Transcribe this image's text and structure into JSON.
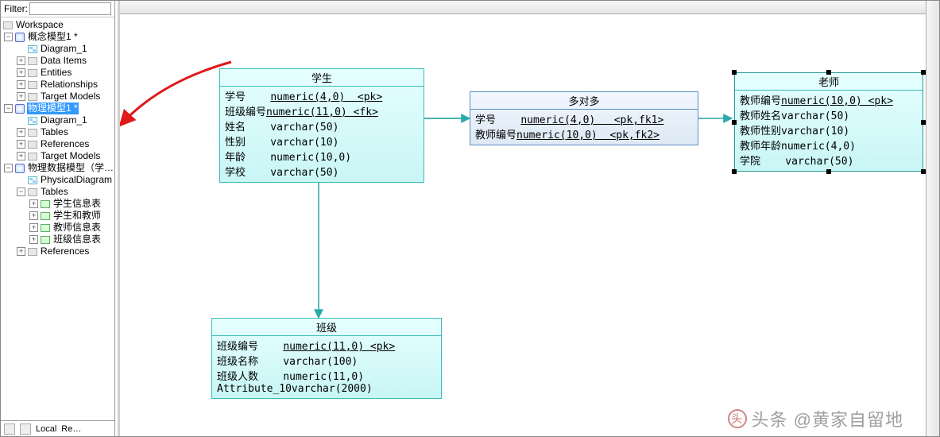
{
  "filter": {
    "label": "Filter:",
    "value": ""
  },
  "tree": {
    "root": "Workspace",
    "model_cpt": "概念模型1 *",
    "diagram1": "Diagram_1",
    "data_items": "Data Items",
    "entities": "Entities",
    "relationships": "Relationships",
    "target_models1": "Target Models",
    "model_phys": "物理模型1 *",
    "diagram1b": "Diagram_1",
    "tables_a": "Tables",
    "references_a": "References",
    "target_models2": "Target Models",
    "model_phys_data": "物理数据模型（学…",
    "phys_diagram": "PhysicalDiagram",
    "tables_b": "Tables",
    "t1": "学生信息表",
    "t2": "学生和教师",
    "t3": "教师信息表",
    "t4": "班级信息表",
    "references_b": "References"
  },
  "bottom": {
    "local": "Local",
    "repo": "Re…"
  },
  "entities": {
    "student": {
      "title": "学生",
      "rows": [
        {
          "name": "学号",
          "type": "numeric(4,0)",
          "key": "<pk>",
          "u": true
        },
        {
          "name": "班级编号",
          "type": "numeric(11,0)",
          "key": "<fk>",
          "u": true
        },
        {
          "name": "姓名",
          "type": "varchar(50)",
          "key": "",
          "u": false
        },
        {
          "name": "性别",
          "type": "varchar(10)",
          "key": "",
          "u": false
        },
        {
          "name": "年龄",
          "type": "numeric(10,0)",
          "key": "",
          "u": false
        },
        {
          "name": "学校",
          "type": "varchar(50)",
          "key": "",
          "u": false
        }
      ]
    },
    "assoc": {
      "title": "多对多",
      "rows": [
        {
          "name": "学号",
          "type": "numeric(4,0)",
          "key": "<pk,fk1>",
          "u": true
        },
        {
          "name": "教师编号",
          "type": "numeric(10,0)",
          "key": "<pk,fk2>",
          "u": true
        }
      ]
    },
    "teacher": {
      "title": "老师",
      "rows": [
        {
          "name": "教师编号",
          "type": "numeric(10,0)",
          "key": "<pk>",
          "u": true
        },
        {
          "name": "教师姓名",
          "type": "varchar(50)",
          "key": "",
          "u": false
        },
        {
          "name": "教师性别",
          "type": "varchar(10)",
          "key": "",
          "u": false
        },
        {
          "name": "教师年龄",
          "type": "numeric(4,0)",
          "key": "",
          "u": false
        },
        {
          "name": "学院",
          "type": "varchar(50)",
          "key": "",
          "u": false
        }
      ]
    },
    "class": {
      "title": "班级",
      "rows": [
        {
          "name": "班级编号",
          "type": "numeric(11,0)",
          "key": "<pk>",
          "u": true
        },
        {
          "name": "班级名称",
          "type": "varchar(100)",
          "key": "",
          "u": false
        },
        {
          "name": "班级人数",
          "type": "numeric(11,0)",
          "key": "",
          "u": false
        },
        {
          "name": "Attribute_10",
          "type": "varchar(2000)",
          "key": "",
          "u": false
        }
      ]
    }
  },
  "watermark": "头条 @黄家自留地"
}
